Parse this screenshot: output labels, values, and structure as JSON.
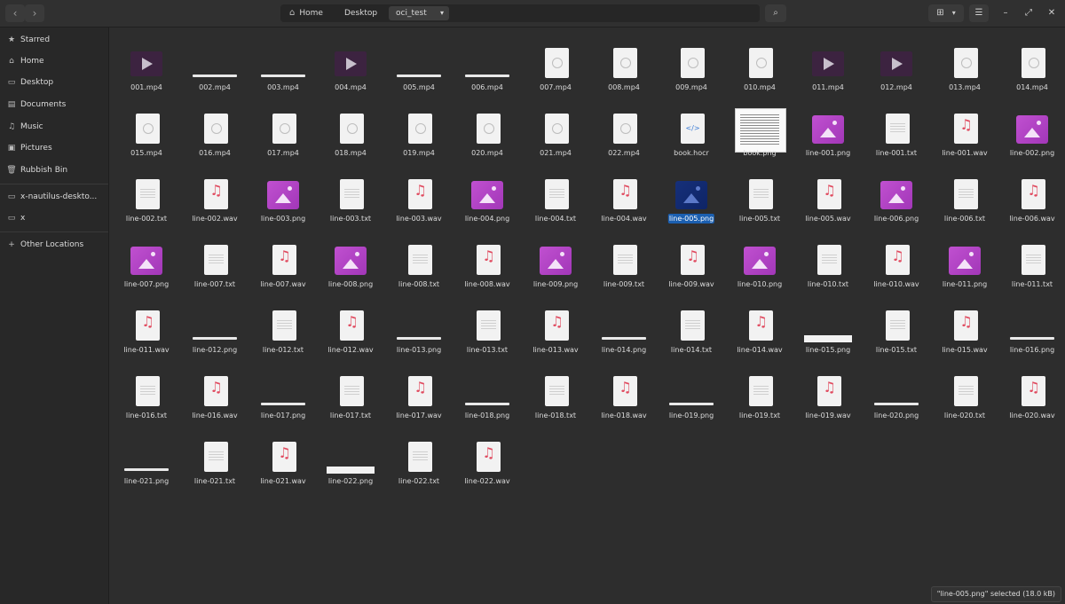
{
  "header": {
    "back_icon": "‹",
    "forward_icon": "›",
    "breadcrumbs": [
      "Home",
      "Desktop",
      "oci_test"
    ],
    "home_symbol": "⌂",
    "dropdown_symbol": "▾",
    "search_symbol": "⌕",
    "view_symbol": "⊞",
    "view_dropdown_symbol": "▾",
    "menu_symbol": "☰",
    "minimize_symbol": "–",
    "maximize_symbol": "⤢",
    "close_symbol": "✕"
  },
  "sidebar": {
    "items": [
      {
        "label": "Starred",
        "icon": "★"
      },
      {
        "label": "Home",
        "icon": "⌂"
      },
      {
        "label": "Desktop",
        "icon": "▭"
      },
      {
        "label": "Documents",
        "icon": "▤"
      },
      {
        "label": "Music",
        "icon": "♫"
      },
      {
        "label": "Pictures",
        "icon": "▣"
      },
      {
        "label": "Rubbish Bin",
        "icon": "🗑"
      },
      {
        "label": "x-nautilus-deskto...",
        "icon": "▭"
      },
      {
        "label": "x",
        "icon": "▭"
      },
      {
        "label": "Other Locations",
        "icon": "+"
      }
    ]
  },
  "files": [
    {
      "name": "001.mp4",
      "type": "video"
    },
    {
      "name": "002.mp4",
      "type": "thin"
    },
    {
      "name": "003.mp4",
      "type": "thin"
    },
    {
      "name": "004.mp4",
      "type": "video"
    },
    {
      "name": "005.mp4",
      "type": "thin"
    },
    {
      "name": "006.mp4",
      "type": "thin"
    },
    {
      "name": "007.mp4",
      "type": "doc"
    },
    {
      "name": "008.mp4",
      "type": "doc"
    },
    {
      "name": "009.mp4",
      "type": "doc"
    },
    {
      "name": "010.mp4",
      "type": "doc"
    },
    {
      "name": "011.mp4",
      "type": "video"
    },
    {
      "name": "012.mp4",
      "type": "video"
    },
    {
      "name": "013.mp4",
      "type": "doc"
    },
    {
      "name": "014.mp4",
      "type": "doc"
    },
    {
      "name": "015.mp4",
      "type": "doc"
    },
    {
      "name": "016.mp4",
      "type": "doc"
    },
    {
      "name": "017.mp4",
      "type": "doc"
    },
    {
      "name": "018.mp4",
      "type": "doc"
    },
    {
      "name": "019.mp4",
      "type": "doc"
    },
    {
      "name": "020.mp4",
      "type": "doc"
    },
    {
      "name": "021.mp4",
      "type": "doc"
    },
    {
      "name": "022.mp4",
      "type": "doc"
    },
    {
      "name": "book.hocr",
      "type": "code"
    },
    {
      "name": "book.png",
      "type": "book"
    },
    {
      "name": "line-001.png",
      "type": "image"
    },
    {
      "name": "line-001.txt",
      "type": "text"
    },
    {
      "name": "line-001.wav",
      "type": "audio"
    },
    {
      "name": "line-002.png",
      "type": "image"
    },
    {
      "name": "line-002.txt",
      "type": "text"
    },
    {
      "name": "line-002.wav",
      "type": "audio"
    },
    {
      "name": "line-003.png",
      "type": "image"
    },
    {
      "name": "line-003.txt",
      "type": "text"
    },
    {
      "name": "line-003.wav",
      "type": "audio"
    },
    {
      "name": "line-004.png",
      "type": "image"
    },
    {
      "name": "line-004.txt",
      "type": "text"
    },
    {
      "name": "line-004.wav",
      "type": "audio"
    },
    {
      "name": "line-005.png",
      "type": "selected-image"
    },
    {
      "name": "line-005.txt",
      "type": "text"
    },
    {
      "name": "line-005.wav",
      "type": "audio"
    },
    {
      "name": "line-006.png",
      "type": "image"
    },
    {
      "name": "line-006.txt",
      "type": "text"
    },
    {
      "name": "line-006.wav",
      "type": "audio"
    },
    {
      "name": "line-007.png",
      "type": "image"
    },
    {
      "name": "line-007.txt",
      "type": "text"
    },
    {
      "name": "line-007.wav",
      "type": "audio"
    },
    {
      "name": "line-008.png",
      "type": "image"
    },
    {
      "name": "line-008.txt",
      "type": "text"
    },
    {
      "name": "line-008.wav",
      "type": "audio"
    },
    {
      "name": "line-009.png",
      "type": "image"
    },
    {
      "name": "line-009.txt",
      "type": "text"
    },
    {
      "name": "line-009.wav",
      "type": "audio"
    },
    {
      "name": "line-010.png",
      "type": "image"
    },
    {
      "name": "line-010.txt",
      "type": "text"
    },
    {
      "name": "line-010.wav",
      "type": "audio"
    },
    {
      "name": "line-011.png",
      "type": "image"
    },
    {
      "name": "line-011.txt",
      "type": "text"
    },
    {
      "name": "line-011.wav",
      "type": "audio"
    },
    {
      "name": "line-012.png",
      "type": "thin"
    },
    {
      "name": "line-012.txt",
      "type": "text"
    },
    {
      "name": "line-012.wav",
      "type": "audio"
    },
    {
      "name": "line-013.png",
      "type": "thin"
    },
    {
      "name": "line-013.txt",
      "type": "text"
    },
    {
      "name": "line-013.wav",
      "type": "audio"
    },
    {
      "name": "line-014.png",
      "type": "thin"
    },
    {
      "name": "line-014.txt",
      "type": "text"
    },
    {
      "name": "line-014.wav",
      "type": "audio"
    },
    {
      "name": "line-015.png",
      "type": "strip"
    },
    {
      "name": "line-015.txt",
      "type": "text"
    },
    {
      "name": "line-015.wav",
      "type": "audio"
    },
    {
      "name": "line-016.png",
      "type": "thin"
    },
    {
      "name": "line-016.txt",
      "type": "text"
    },
    {
      "name": "line-016.wav",
      "type": "audio"
    },
    {
      "name": "line-017.png",
      "type": "thin"
    },
    {
      "name": "line-017.txt",
      "type": "text"
    },
    {
      "name": "line-017.wav",
      "type": "audio"
    },
    {
      "name": "line-018.png",
      "type": "thin"
    },
    {
      "name": "line-018.txt",
      "type": "text"
    },
    {
      "name": "line-018.wav",
      "type": "audio"
    },
    {
      "name": "line-019.png",
      "type": "thin"
    },
    {
      "name": "line-019.txt",
      "type": "text"
    },
    {
      "name": "line-019.wav",
      "type": "audio"
    },
    {
      "name": "line-020.png",
      "type": "thin"
    },
    {
      "name": "line-020.txt",
      "type": "text"
    },
    {
      "name": "line-020.wav",
      "type": "audio"
    },
    {
      "name": "line-021.png",
      "type": "thin"
    },
    {
      "name": "line-021.txt",
      "type": "text"
    },
    {
      "name": "line-021.wav",
      "type": "audio"
    },
    {
      "name": "line-022.png",
      "type": "strip"
    },
    {
      "name": "line-022.txt",
      "type": "text"
    },
    {
      "name": "line-022.wav",
      "type": "audio"
    }
  ],
  "status": {
    "text": "\"line-005.png\" selected  (18.0 kB)"
  },
  "colors": {
    "window_bg": "#2d2d2d",
    "sidebar_bg": "#282828",
    "selection": "#1b5fb0",
    "image_accent": "#b443c4",
    "audio_accent": "#e04a5f"
  }
}
